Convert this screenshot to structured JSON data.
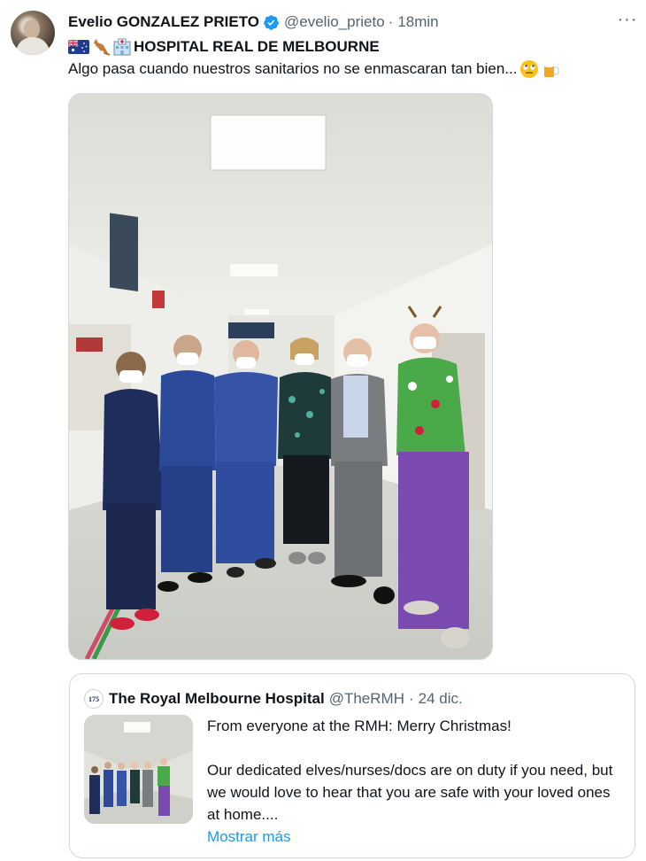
{
  "tweet": {
    "author_name": "Evelio GONZALEZ PRIETO",
    "handle": "@evelio_prieto",
    "separator": "·",
    "time": "18min",
    "more_label": "···",
    "title_line": "HOSPITAL REAL DE MELBOURNE",
    "body_text": "Algo pasa cuando nuestros sanitarios no se enmascaran tan bien...",
    "title_icons": [
      "australia-flag-icon",
      "kangaroo-icon",
      "hospital-icon"
    ],
    "body_icons": [
      "rolling-eyes-emoji-icon",
      "beer-mug-emoji-icon"
    ],
    "verified_icon": "verified-badge-icon"
  },
  "quoted_tweet": {
    "author_name": "The Royal Melbourne Hospital",
    "avatar_text": "175",
    "handle": "@TheRMH",
    "separator": "·",
    "time": "24 dic.",
    "text_line1": "From everyone at the RMH: Merry Christmas!",
    "text_line2": "Our dedicated elves/nurses/docs are on duty if you need, but we would love to hear that you are safe with your loved ones at home....",
    "show_more": "Mostrar más"
  },
  "colors": {
    "link": "#1d9bf0",
    "secondary_text": "#536471",
    "border": "#cfd9de",
    "verified": "#1d9bf0"
  }
}
